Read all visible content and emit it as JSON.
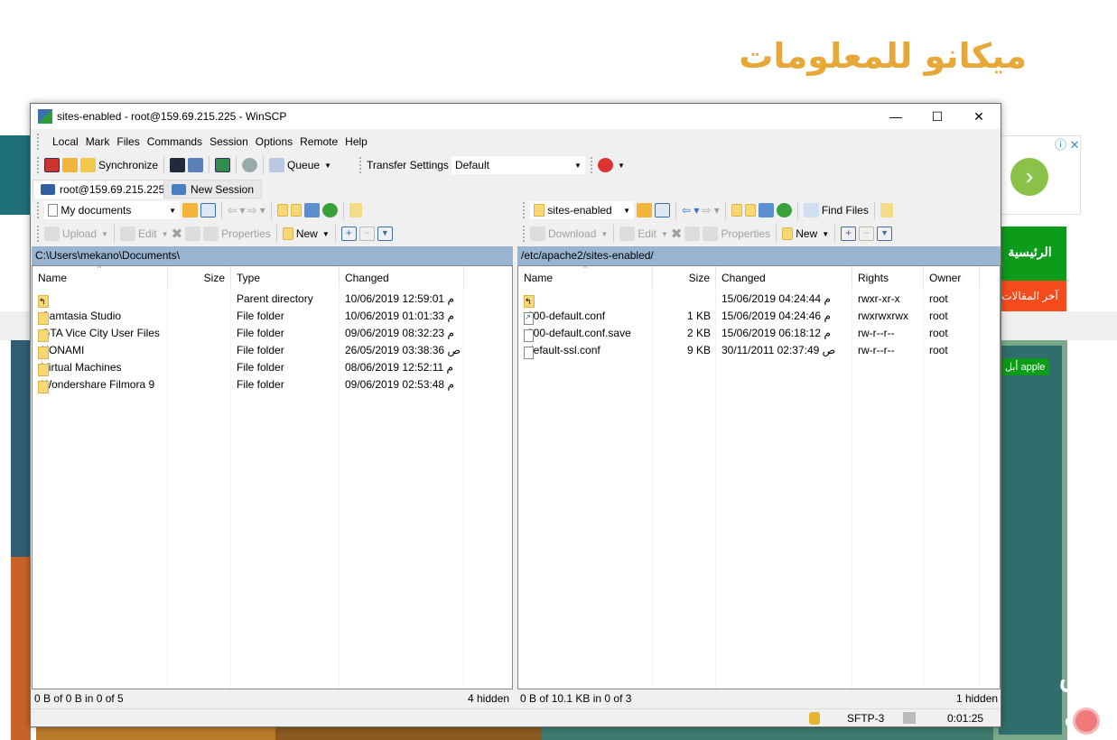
{
  "website": {
    "logo_text": "ميكانو للمعلومات",
    "nav_home": "الرئيسية",
    "nav_latest": "آخر المقالات",
    "tag_apple": "أبل apple",
    "feature_title": "طرق تلقي",
    "ad_arrow": "›",
    "ad_info": "ⓘ ✕"
  },
  "window": {
    "title": "sites-enabled - root@159.69.215.225 - WinSCP",
    "controls": {
      "minimize": "—",
      "maximize": "☐",
      "close": "✕"
    },
    "menu": [
      "Local",
      "Mark",
      "Files",
      "Commands",
      "Session",
      "Options",
      "Remote",
      "Help"
    ],
    "toolbar": {
      "synchronize": "Synchronize",
      "queue": "Queue",
      "transfer_settings_label": "Transfer Settings",
      "transfer_settings_value": "Default"
    },
    "tabs": [
      {
        "label": "root@159.69.215.225",
        "active": true
      },
      {
        "label": "New Session",
        "active": false
      }
    ],
    "left": {
      "location": "My documents",
      "actions": {
        "upload": "Upload",
        "edit": "Edit",
        "properties": "Properties",
        "new": "New"
      },
      "path": "C:\\Users\\mekano\\Documents\\",
      "columns": [
        "Name",
        "Size",
        "Type",
        "Changed"
      ],
      "rows": [
        {
          "name": "..",
          "size": "",
          "type": "Parent directory",
          "changed": "10/06/2019  12:59:01 م",
          "icon": "parent"
        },
        {
          "name": "Camtasia Studio",
          "size": "",
          "type": "File folder",
          "changed": "10/06/2019  01:01:33 م",
          "icon": "folder"
        },
        {
          "name": "GTA Vice City User Files",
          "size": "",
          "type": "File folder",
          "changed": "09/06/2019  08:32:23 م",
          "icon": "folder"
        },
        {
          "name": "KONAMI",
          "size": "",
          "type": "File folder",
          "changed": "26/05/2019  03:38:36 ص",
          "icon": "folder"
        },
        {
          "name": "Virtual Machines",
          "size": "",
          "type": "File folder",
          "changed": "08/06/2019  12:52:11 م",
          "icon": "folder"
        },
        {
          "name": "Wondershare Filmora 9",
          "size": "",
          "type": "File folder",
          "changed": "09/06/2019  02:53:48 م",
          "icon": "folder"
        }
      ],
      "status": "0 B of 0 B in 0 of 5",
      "hidden": "4 hidden"
    },
    "right": {
      "location": "sites-enabled",
      "find_files": "Find Files",
      "actions": {
        "download": "Download",
        "edit": "Edit",
        "properties": "Properties",
        "new": "New"
      },
      "path": "/etc/apache2/sites-enabled/",
      "columns": [
        "Name",
        "Size",
        "Changed",
        "Rights",
        "Owner"
      ],
      "rows": [
        {
          "name": "..",
          "size": "",
          "changed": "15/06/2019 04:24:44 م",
          "rights": "rwxr-xr-x",
          "owner": "root",
          "icon": "parent"
        },
        {
          "name": "000-default.conf",
          "size": "1 KB",
          "changed": "15/06/2019 04:24:46 م",
          "rights": "rwxrwxrwx",
          "owner": "root",
          "icon": "link"
        },
        {
          "name": "000-default.conf.save",
          "size": "2 KB",
          "changed": "15/06/2019 06:18:12 م",
          "rights": "rw-r--r--",
          "owner": "root",
          "icon": "file"
        },
        {
          "name": "default-ssl.conf",
          "size": "9 KB",
          "changed": "30/11/2011 02:37:49 ص",
          "rights": "rw-r--r--",
          "owner": "root",
          "icon": "file"
        }
      ],
      "status": "0 B of 10.1 KB in 0 of 3",
      "hidden": "1 hidden"
    },
    "statusbar": {
      "protocol": "SFTP-3",
      "elapsed": "0:01:25"
    }
  }
}
